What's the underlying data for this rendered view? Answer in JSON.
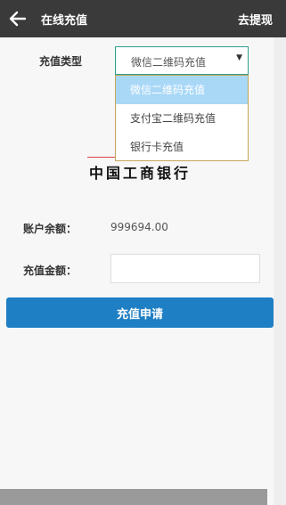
{
  "header": {
    "title": "在线充值",
    "withdraw_label": "去提现"
  },
  "form": {
    "type_label": "充值类型",
    "type_selected": "微信二维码充值",
    "type_options": [
      "微信二维码充值",
      "支付宝二维码充值",
      "银行卡充值"
    ],
    "balance_label": "账户余额：",
    "balance_value": "999694.00",
    "amount_label": "充值金额：",
    "amount_value": "",
    "submit_label": "充值申请"
  },
  "bank": {
    "logo_text": "中国工商银行"
  },
  "icons": {
    "back": "arrow-left-icon",
    "dropdown": "caret-down-icon"
  },
  "colors": {
    "topbar": "#3a3a3a",
    "primary": "#1f7fc4",
    "selected_option": "#a9d8f7"
  }
}
